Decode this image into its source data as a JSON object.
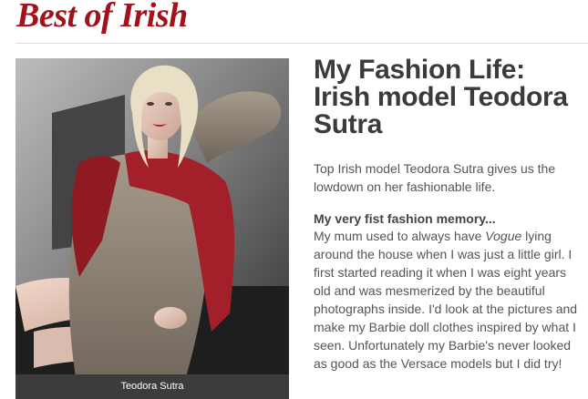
{
  "section": {
    "title": "Best of Irish"
  },
  "photo": {
    "caption": "Teodora Sutra"
  },
  "article": {
    "headline": "My Fashion Life: Irish model Teodora Sutra",
    "intro": "Top Irish model Teodora Sutra gives us the lowdown on her fashionable life.",
    "subhead": "My very fist fashion memory...",
    "body_part1": "My mum used to always have ",
    "body_em": "Vogue",
    "body_part2": " lying around the house when I was just a little girl. I first started reading it when I was eight years old and was mesmerized by the beautiful photographs inside. I'd look at the pictures and make my Barbie doll clothes inspired by what I seen. Unfortunately my Barbie's never looked as good as the Versace models but I did try!"
  }
}
